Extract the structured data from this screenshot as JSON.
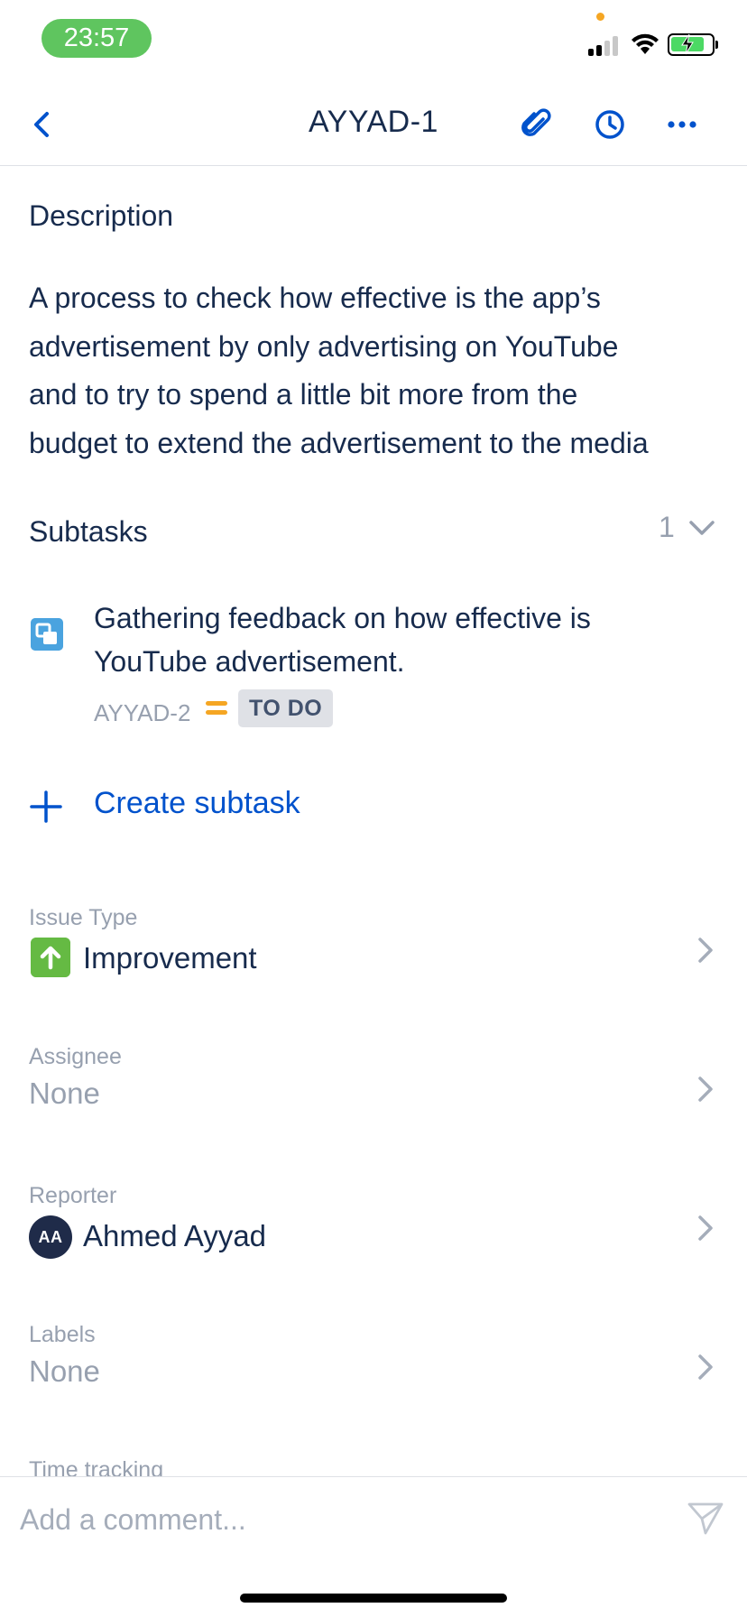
{
  "status_bar": {
    "time": "23:57"
  },
  "header": {
    "title": "AYYAD-1"
  },
  "description": {
    "heading": "Description",
    "lines": [
      "A process to check how effective is the app’s",
      "advertisement by only advertising on YouTube",
      "and to try to spend a little bit more from the",
      "budget to extend the advertisement to the media"
    ]
  },
  "subtasks": {
    "heading": "Subtasks",
    "count": "1",
    "items": [
      {
        "title": "Gathering feedback on how effective is YouTube advertisement.",
        "key": "AYYAD-2",
        "status": "TO DO",
        "priority": "medium"
      }
    ],
    "create_label": "Create subtask"
  },
  "fields": {
    "issue_type": {
      "label": "Issue Type",
      "value": "Improvement"
    },
    "assignee": {
      "label": "Assignee",
      "value": "None"
    },
    "reporter": {
      "label": "Reporter",
      "value": "Ahmed Ayyad",
      "initials": "AA"
    },
    "labels": {
      "label": "Labels",
      "value": "None"
    },
    "time_tracking": {
      "label": "Time tracking"
    }
  },
  "comment": {
    "placeholder": "Add a comment..."
  },
  "colors": {
    "accent": "#0052cc",
    "text": "#172b4d",
    "muted": "#97a0af",
    "time_pill": "#5fc55f",
    "improvement": "#65ba43",
    "subtask": "#4aa3df",
    "priority_medium": "#f5a623"
  }
}
